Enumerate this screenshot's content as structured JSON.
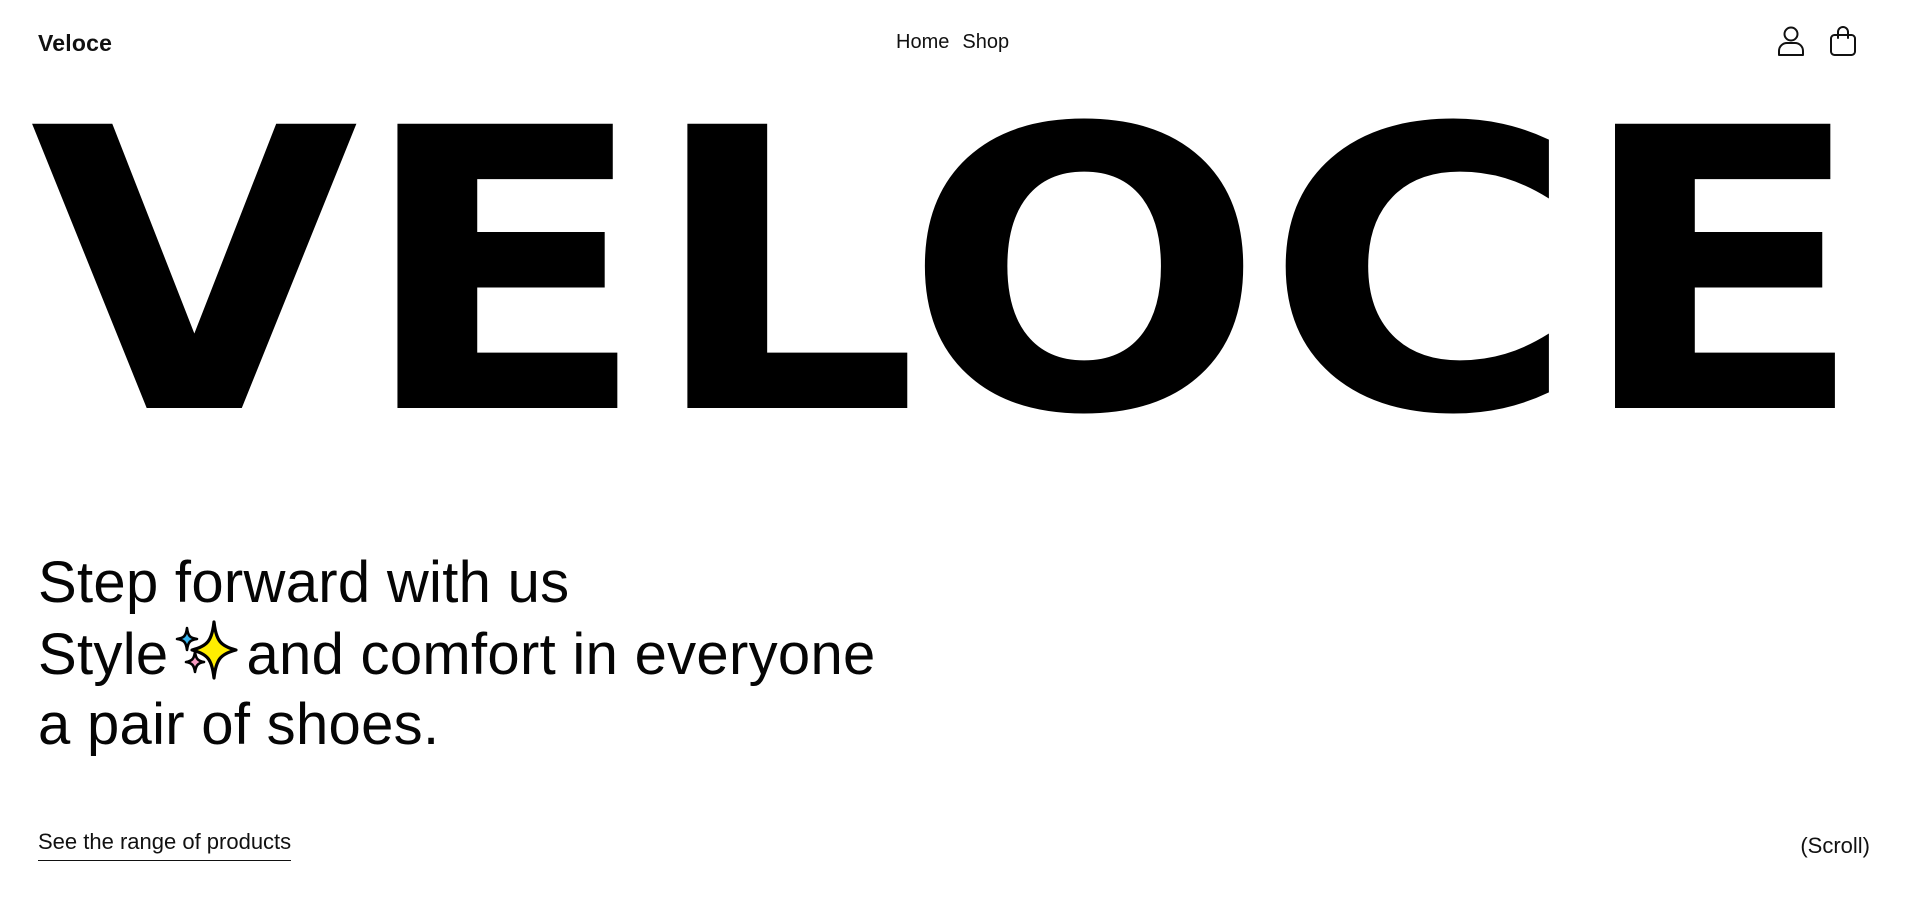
{
  "header": {
    "brand": "Veloce",
    "nav": [
      {
        "label": "Home"
      },
      {
        "label": "Shop"
      }
    ],
    "icons": [
      "user-icon",
      "shopping-bag-icon"
    ]
  },
  "hero": {
    "wordmark": "VELOCE"
  },
  "tagline": {
    "line1": "Step forward with us",
    "line2_before": "Style",
    "line2_icon": "sparkles-icon",
    "line2_after": "and comfort in everyone",
    "line3": "a pair of shoes."
  },
  "footer": {
    "cta_label": "See the range of products",
    "scroll_hint": "(Scroll)"
  },
  "colors": {
    "text": "#000000",
    "background": "#ffffff",
    "sparkle_main": "#ffee00",
    "sparkle_blue": "#35b4ef",
    "sparkle_pink": "#f79ac0"
  }
}
